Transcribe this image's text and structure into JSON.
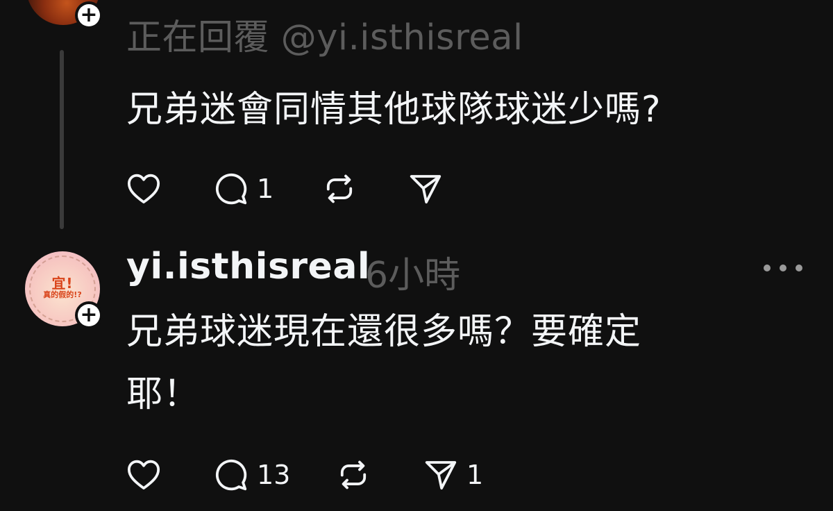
{
  "post_1": {
    "reply_to": "正在回覆 @yi.isthisreal",
    "text": "兄弟迷會同情其他球隊球迷少嗎?",
    "actions": {
      "like_count": "",
      "comment_count": "1",
      "repost_count": "",
      "share_count": ""
    }
  },
  "post_2": {
    "username": "yi.isthisreal",
    "timestamp": "6小時",
    "avatar_logo": {
      "line1": "宜!",
      "line2": "真的假的!?"
    },
    "text_line1": "兄弟球迷現在還很多嗎？要確定",
    "text_line2": "耶！",
    "actions": {
      "like_count": "",
      "comment_count": "13",
      "repost_count": "",
      "share_count": "1"
    }
  },
  "icons": {
    "follow": "plus-icon",
    "like": "heart-icon",
    "comment": "comment-bubble-icon",
    "repost": "repost-icon",
    "share": "send-icon",
    "more": "more-dots-icon"
  },
  "colors": {
    "background": "#101010",
    "text": "#f3f5f7",
    "muted": "#5c5c5c"
  }
}
